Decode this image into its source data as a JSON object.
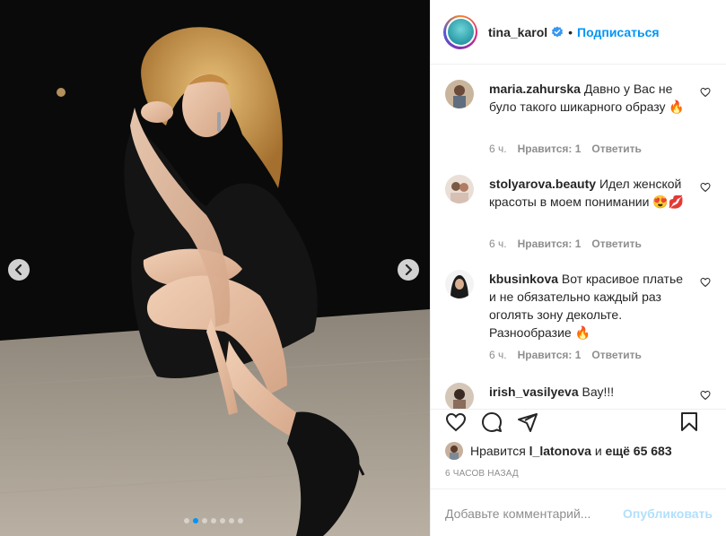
{
  "header": {
    "username": "tina_karol",
    "separator": "•",
    "follow_label": "Подписаться"
  },
  "comments": [
    {
      "user": "maria.zahurska",
      "text": "Давно у Вас не було такого шикарного образу",
      "emoji": "🔥",
      "time": "6 ч.",
      "likes": "Нравится: 1",
      "reply": "Ответить"
    },
    {
      "user": "stolyarova.beauty",
      "text": "Идел женской красоты в моем понимании",
      "emoji": "😍💋",
      "time": "6 ч.",
      "likes": "Нравится: 1",
      "reply": "Ответить"
    },
    {
      "user": "kbusinkova",
      "text": "Вот красивое платье и не обязательно каждый раз оголять зону декольте. Разнообразие",
      "emoji": "🔥",
      "time": "6 ч.",
      "likes": "Нравится: 1",
      "reply": "Ответить"
    },
    {
      "user": "irish_vasilyeva",
      "text": "Вау!!!",
      "emoji": ""
    }
  ],
  "likes": {
    "prefix": "Нравится",
    "user": "l_latonova",
    "conj": "и",
    "more": "ещё 65 683"
  },
  "timestamp": "6 ЧАСОВ НАЗАД",
  "add_comment": {
    "placeholder": "Добавьте комментарий...",
    "publish_label": "Опубликовать"
  },
  "carousel": {
    "slides": 7,
    "active_index": 1
  },
  "colors": {
    "accent": "#0095f6",
    "publish_disabled": "#b2dffc",
    "meta": "#8e8e8e"
  },
  "icons": [
    "chevron-left-icon",
    "chevron-right-icon",
    "verified-icon",
    "heart-icon",
    "comment-icon",
    "share-icon",
    "bookmark-icon"
  ]
}
